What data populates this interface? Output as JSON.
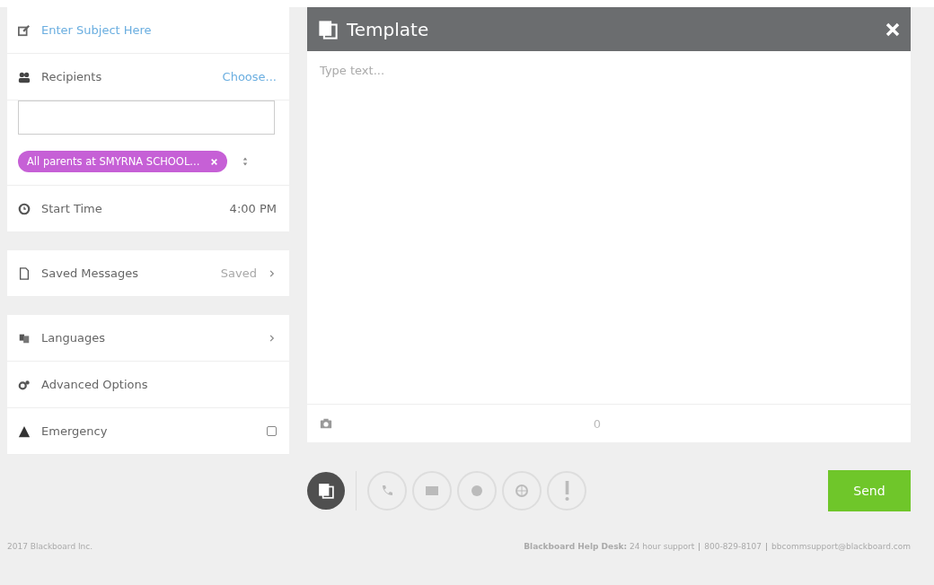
{
  "subject": {
    "placeholder": "Enter Subject Here"
  },
  "recipients": {
    "label": "Recipients",
    "action": "Choose...",
    "tags": [
      "All parents at SMYRNA SCHOOL..."
    ]
  },
  "start_time": {
    "label": "Start Time",
    "value": "4:00 PM"
  },
  "saved_messages": {
    "label": "Saved Messages",
    "value": "Saved"
  },
  "options": [
    {
      "kind": "languages",
      "label": "Languages"
    },
    {
      "kind": "advanced",
      "label": "Advanced Options"
    }
  ],
  "emergency": {
    "label": "Emergency",
    "checked": false
  },
  "editor": {
    "title": "Template",
    "placeholder": "Type text...",
    "count": "0"
  },
  "channels": [
    {
      "kind": "template",
      "selected": true
    },
    {
      "kind": "phone",
      "selected": false
    },
    {
      "kind": "email",
      "selected": false
    },
    {
      "kind": "sms",
      "selected": false
    },
    {
      "kind": "web",
      "selected": false
    },
    {
      "kind": "alert",
      "selected": false
    }
  ],
  "send_button": "Send",
  "footer": {
    "copyright": "2017 Blackboard Inc.",
    "help_label": "Blackboard Help Desk:",
    "help_text": " 24 hour support",
    "phone": "800-829-8107",
    "email": "bbcommsupport@blackboard.com"
  }
}
